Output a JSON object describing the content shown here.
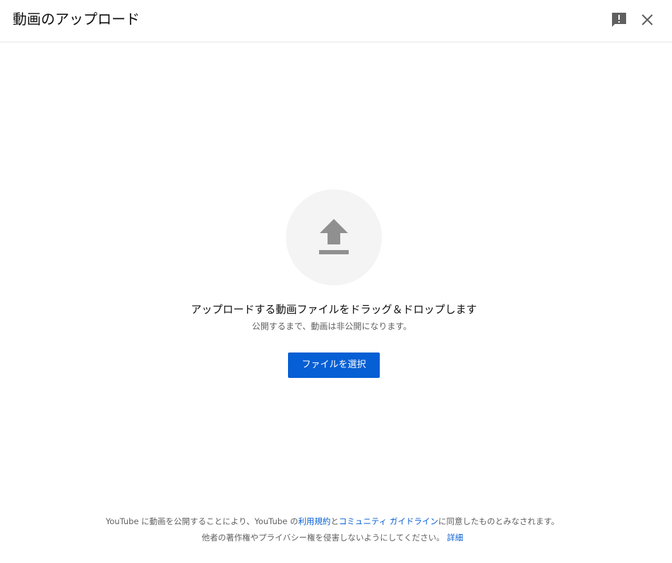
{
  "dialog": {
    "title": "動画のアップロード"
  },
  "header": {
    "feedback_icon": "feedback-icon",
    "close_icon": "close-icon"
  },
  "upload": {
    "icon": "upload-arrow-icon",
    "drop_text": "アップロードする動画ファイルをドラッグ＆ドロップします",
    "sub_text": "公開するまで、動画は非公開になります。",
    "select_button_label": "ファイルを選択"
  },
  "footer": {
    "line1_prefix": "YouTube に動画を公開することにより、YouTube の",
    "terms_link": "利用規約",
    "and": "と",
    "guidelines_link": "コミュニティ ガイドライン",
    "line1_suffix": "に同意したものとみなされます。",
    "line2_text": "他者の著作権やプライバシー権を侵害しないようにしてください。",
    "details_link": "詳細"
  },
  "colors": {
    "accent": "#065fd4",
    "icon": "#606060",
    "upload_icon": "#909090",
    "circle_bg": "#f4f4f4",
    "divider": "#e5e5e5"
  }
}
